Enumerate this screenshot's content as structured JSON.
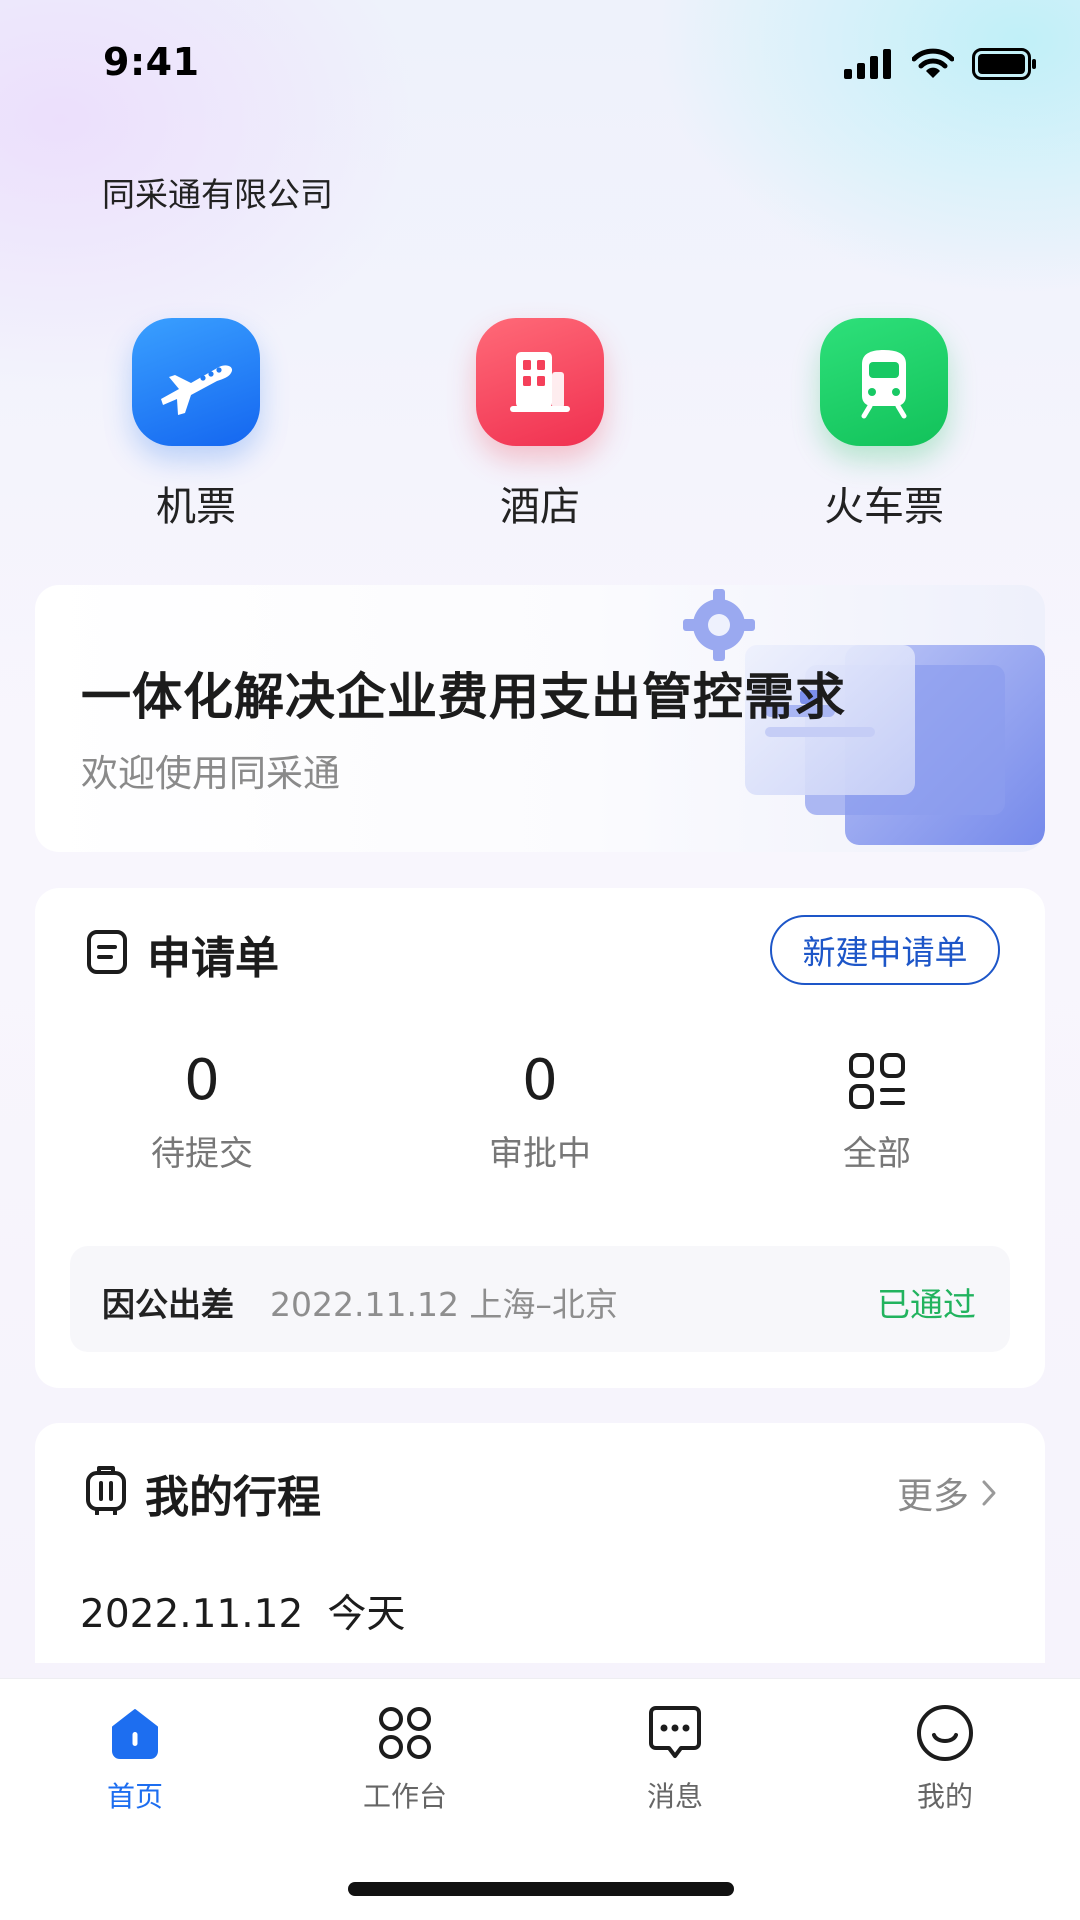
{
  "status_bar": {
    "time": "9:41"
  },
  "company": "同采通有限公司",
  "quick_nav": [
    {
      "label": "机票",
      "icon": "airplane-icon",
      "color": "#1f7bf5"
    },
    {
      "label": "酒店",
      "icon": "hotel-icon",
      "color": "#f5405a"
    },
    {
      "label": "火车票",
      "icon": "train-icon",
      "color": "#18c964"
    }
  ],
  "banner": {
    "title": "一体化解决企业费用支出管控需求",
    "subtitle": "欢迎使用同采通"
  },
  "application": {
    "title": "申请单",
    "new_button": "新建申请单",
    "stats": [
      {
        "value": "0",
        "label": "待提交"
      },
      {
        "value": "0",
        "label": "审批中"
      },
      {
        "label": "全部",
        "icon": "grid-list-icon"
      }
    ],
    "item": {
      "type": "因公出差",
      "detail": "2022.11.12 上海–北京",
      "status": "已通过",
      "status_color": "#22b35e"
    }
  },
  "trips": {
    "title": "我的行程",
    "more": "更多",
    "date": "2022.11.12",
    "day": "今天"
  },
  "tab_bar": {
    "active_color": "#1d6ef0",
    "tabs": [
      {
        "label": "首页",
        "icon": "home-icon",
        "active": true
      },
      {
        "label": "工作台",
        "icon": "workbench-icon",
        "active": false
      },
      {
        "label": "消息",
        "icon": "message-icon",
        "active": false
      },
      {
        "label": "我的",
        "icon": "profile-icon",
        "active": false
      }
    ]
  }
}
